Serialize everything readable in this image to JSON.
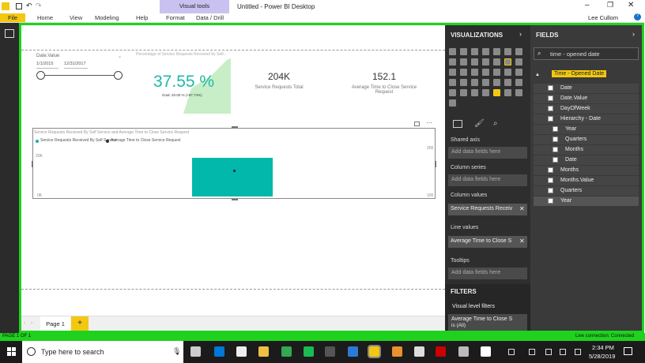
{
  "window": {
    "title": "Untitled - Power BI Desktop",
    "context_tab": "Visual tools",
    "user": "Lee Cullom"
  },
  "ribbon": {
    "tabs": [
      "File",
      "Home",
      "View",
      "Modeling",
      "Help",
      "Format",
      "Data / Drill"
    ]
  },
  "slicer": {
    "title": "Date.Value",
    "start": "1/1/2015",
    "end": "12/31/2017"
  },
  "kpi": {
    "title": "Percentage of Service Requests Received by Self...",
    "value": "37.55 %",
    "goal": "Goal: 20.00 % (+87.74%)"
  },
  "card1": {
    "value": "204K",
    "label": "Service Requests Total"
  },
  "card2": {
    "value": "152.1",
    "label": "Average Time to Close Service Request"
  },
  "combo": {
    "title": "Service Requests Received By Self Service and Average Time to Close Service Request",
    "legend1": "Service Requests Received By Self Service",
    "legend2": "Average Time to Close Service Request",
    "y_left_top": "20K",
    "y_left_bottom": "0K",
    "y_right_top": "200",
    "y_right_bottom": "100",
    "bar_color": "#01b8aa"
  },
  "pages": {
    "current": "Page 1",
    "add": "+"
  },
  "visualizations": {
    "header": "VISUALIZATIONS",
    "shared_axis": "Shared axis",
    "add_fields": "Add data fields here",
    "column_series": "Column series",
    "column_values": "Column values",
    "column_values_field": "Service Requests Receiv",
    "line_values": "Line values",
    "line_values_field": "Average Time to Close S",
    "tooltips": "Tooltips",
    "filters": "FILTERS",
    "visual_level": "Visual level filters",
    "filter_field": "Average Time to Close S",
    "filter_sub": "is (All)"
  },
  "fields": {
    "header": "FIELDS",
    "search": "time - opened date",
    "table": "Time - Opened Date",
    "items": [
      "Date",
      "Date.Value",
      "DayOfWeek",
      "Hierarchy - Date",
      "Year",
      "Quarters",
      "Months",
      "Date",
      "Months",
      "Months.Value",
      "Quarters",
      "Year"
    ]
  },
  "status": {
    "page": "PAGE 1 OF 1",
    "connection": "Live connection: Connected"
  },
  "taskbar": {
    "search": "Type here to search",
    "time": "2:34 PM",
    "date": "5/28/2019"
  }
}
